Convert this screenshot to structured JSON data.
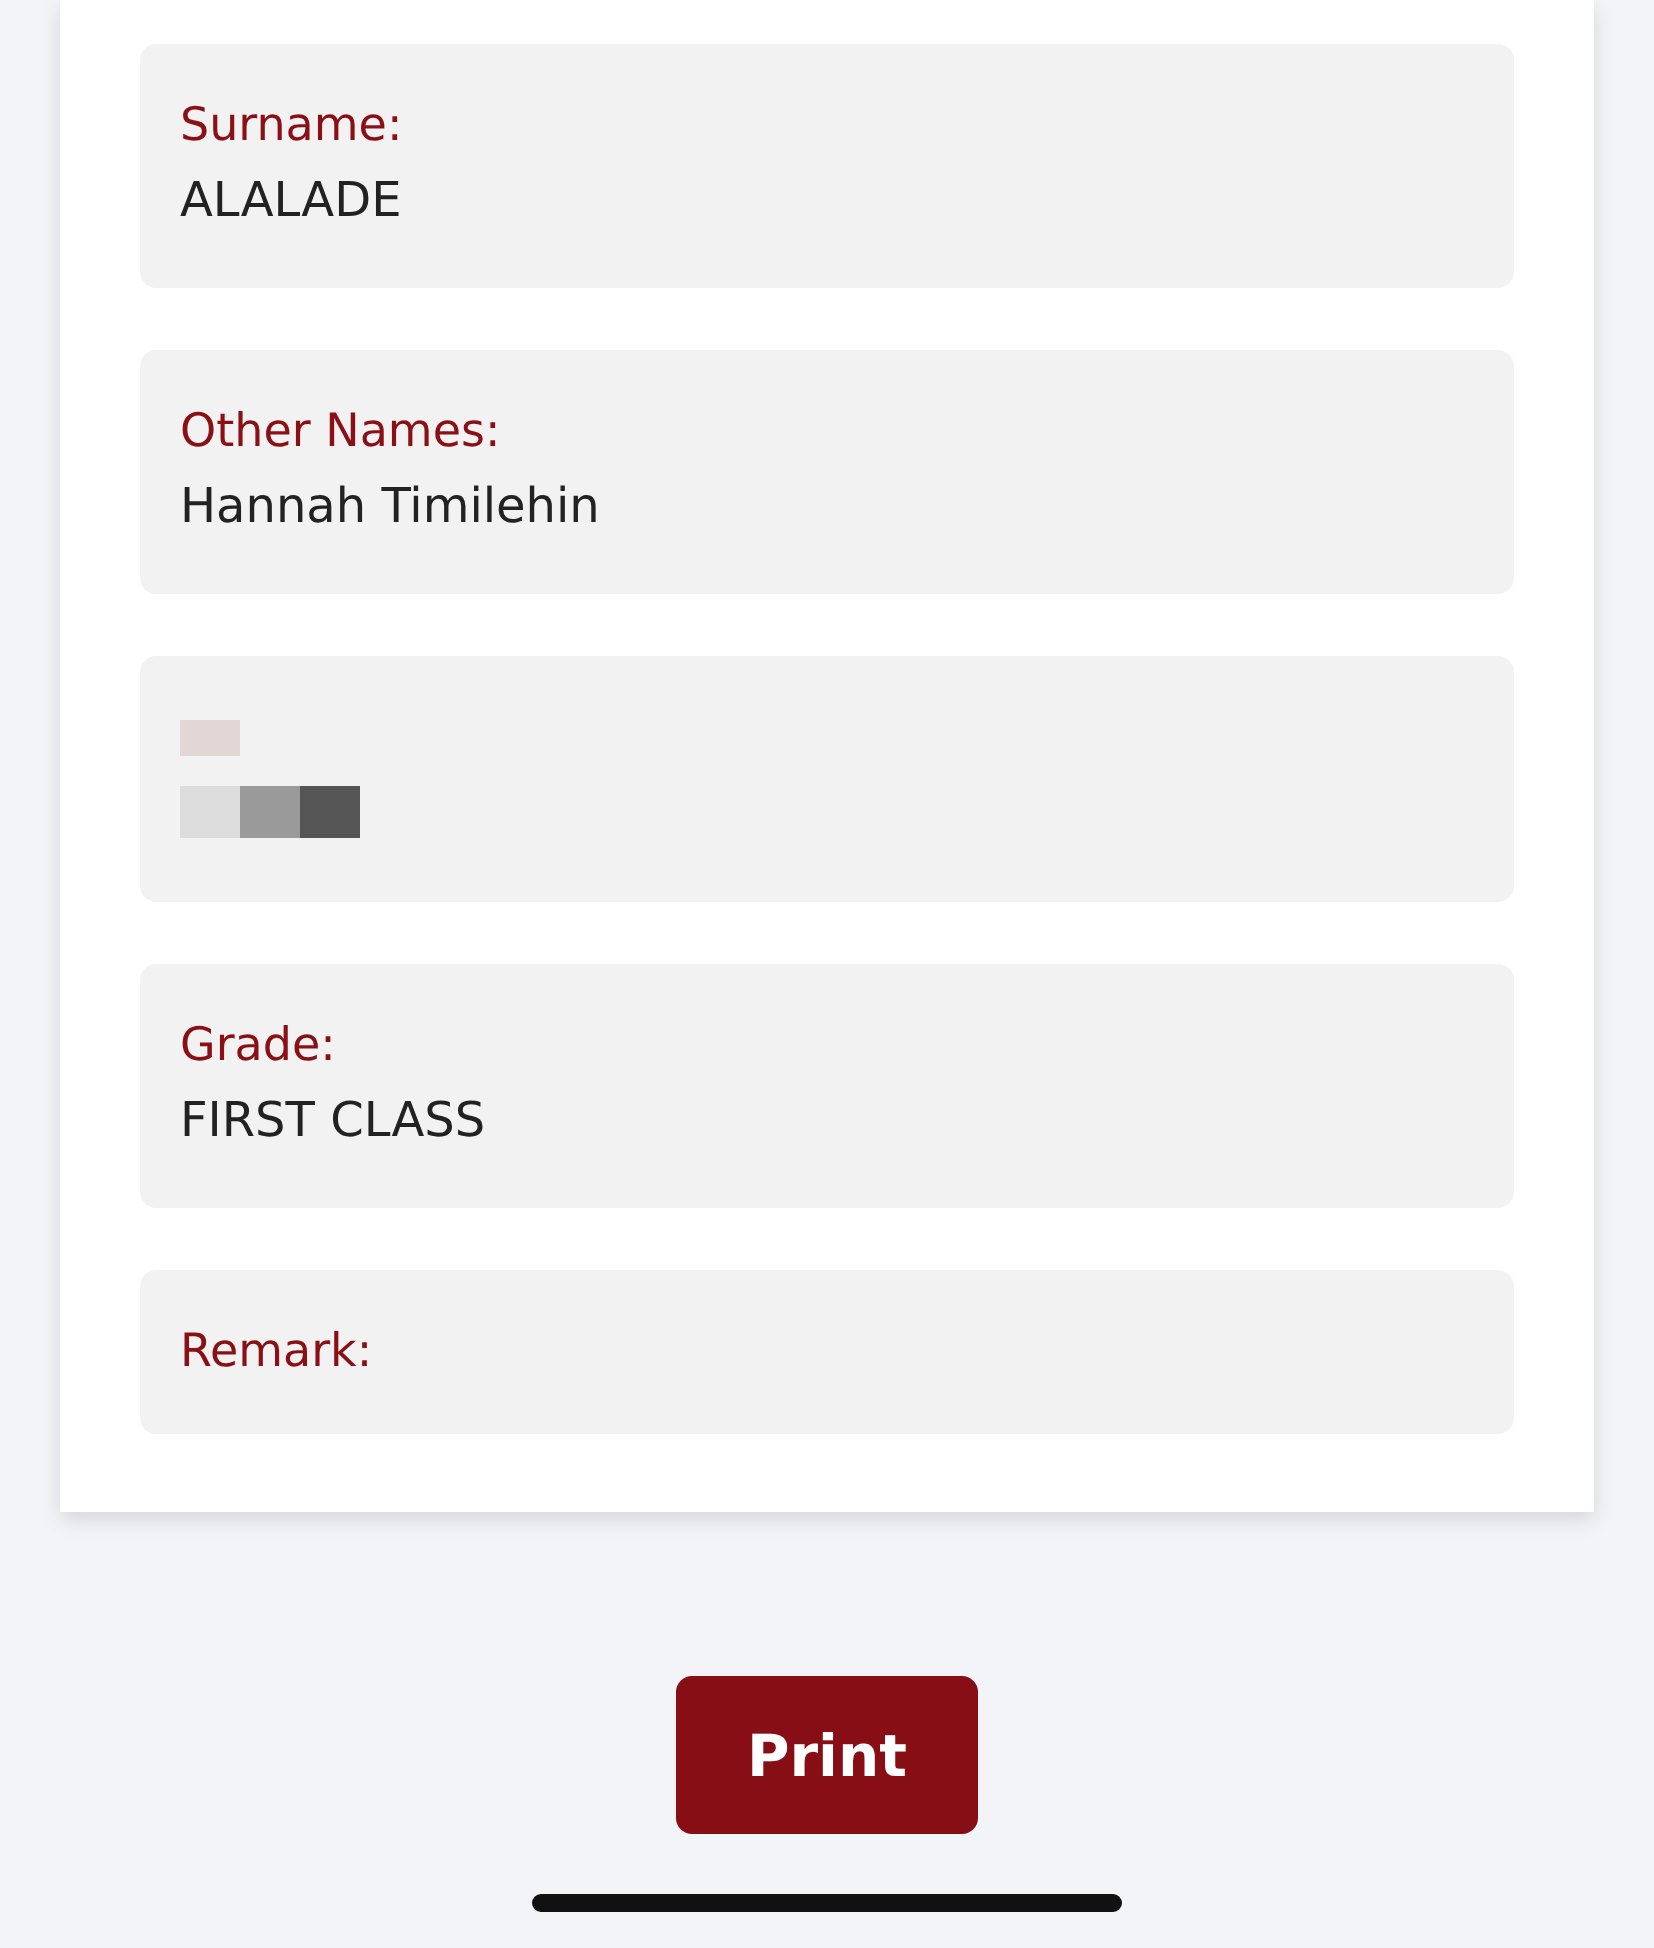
{
  "fields": [
    {
      "kind": "text",
      "label": "Surname:",
      "value": "ALALADE"
    },
    {
      "kind": "text",
      "label": "Other Names:",
      "value": "Hannah Timilehin"
    },
    {
      "kind": "redacted"
    },
    {
      "kind": "text",
      "label": "Grade:",
      "value": "FIRST CLASS"
    },
    {
      "kind": "text",
      "label": "Remark:"
    }
  ],
  "print_button": {
    "label": "Print"
  }
}
